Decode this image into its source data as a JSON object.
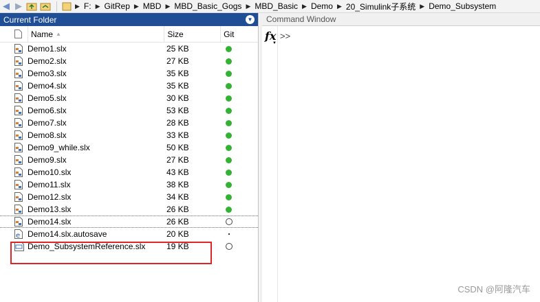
{
  "address_bar": {
    "crumbs": [
      "F:",
      "GitRep",
      "MBD",
      "MBD_Basic_Gogs",
      "MBD_Basic",
      "Demo",
      "20_Simulink子系统",
      "Demo_Subsystem"
    ]
  },
  "current_folder": {
    "title": "Current Folder",
    "columns": {
      "name": "Name",
      "size": "Size",
      "git": "Git"
    },
    "files": [
      {
        "name": "Demo1.slx",
        "size": "25 KB",
        "git": "green",
        "icon": "slx-file-icon"
      },
      {
        "name": "Demo2.slx",
        "size": "27 KB",
        "git": "green",
        "icon": "slx-file-icon"
      },
      {
        "name": "Demo3.slx",
        "size": "35 KB",
        "git": "green",
        "icon": "slx-file-icon"
      },
      {
        "name": "Demo4.slx",
        "size": "35 KB",
        "git": "green",
        "icon": "slx-file-icon"
      },
      {
        "name": "Demo5.slx",
        "size": "30 KB",
        "git": "green",
        "icon": "slx-file-icon"
      },
      {
        "name": "Demo6.slx",
        "size": "53 KB",
        "git": "green",
        "icon": "slx-file-icon"
      },
      {
        "name": "Demo7.slx",
        "size": "28 KB",
        "git": "green",
        "icon": "slx-file-icon"
      },
      {
        "name": "Demo8.slx",
        "size": "33 KB",
        "git": "green",
        "icon": "slx-file-icon"
      },
      {
        "name": "Demo9_while.slx",
        "size": "50 KB",
        "git": "green",
        "icon": "slx-file-icon"
      },
      {
        "name": "Demo9.slx",
        "size": "27 KB",
        "git": "green",
        "icon": "slx-file-icon"
      },
      {
        "name": "Demo10.slx",
        "size": "43 KB",
        "git": "green",
        "icon": "slx-file-icon"
      },
      {
        "name": "Demo11.slx",
        "size": "38 KB",
        "git": "green",
        "icon": "slx-file-icon"
      },
      {
        "name": "Demo12.slx",
        "size": "34 KB",
        "git": "green",
        "icon": "slx-file-icon"
      },
      {
        "name": "Demo13.slx",
        "size": "26 KB",
        "git": "green",
        "icon": "slx-file-icon"
      },
      {
        "name": "Demo14.slx",
        "size": "26 KB",
        "git": "ring",
        "icon": "slx-file-icon"
      },
      {
        "name": "Demo14.slx.autosave",
        "size": "20 KB",
        "git": "tiny",
        "icon": "autosave-file-icon"
      },
      {
        "name": "Demo_SubsystemReference.slx",
        "size": "19 KB",
        "git": "ring",
        "icon": "subsystem-reference-file-icon"
      }
    ]
  },
  "command_window": {
    "title": "Command Window",
    "fx_label": "fx",
    "prompt": ">>"
  },
  "watermark": "CSDN @阿隆汽车",
  "colors": {
    "panel_header": "#1f4e96",
    "git_clean": "#34b233",
    "highlight": "#e02424"
  }
}
